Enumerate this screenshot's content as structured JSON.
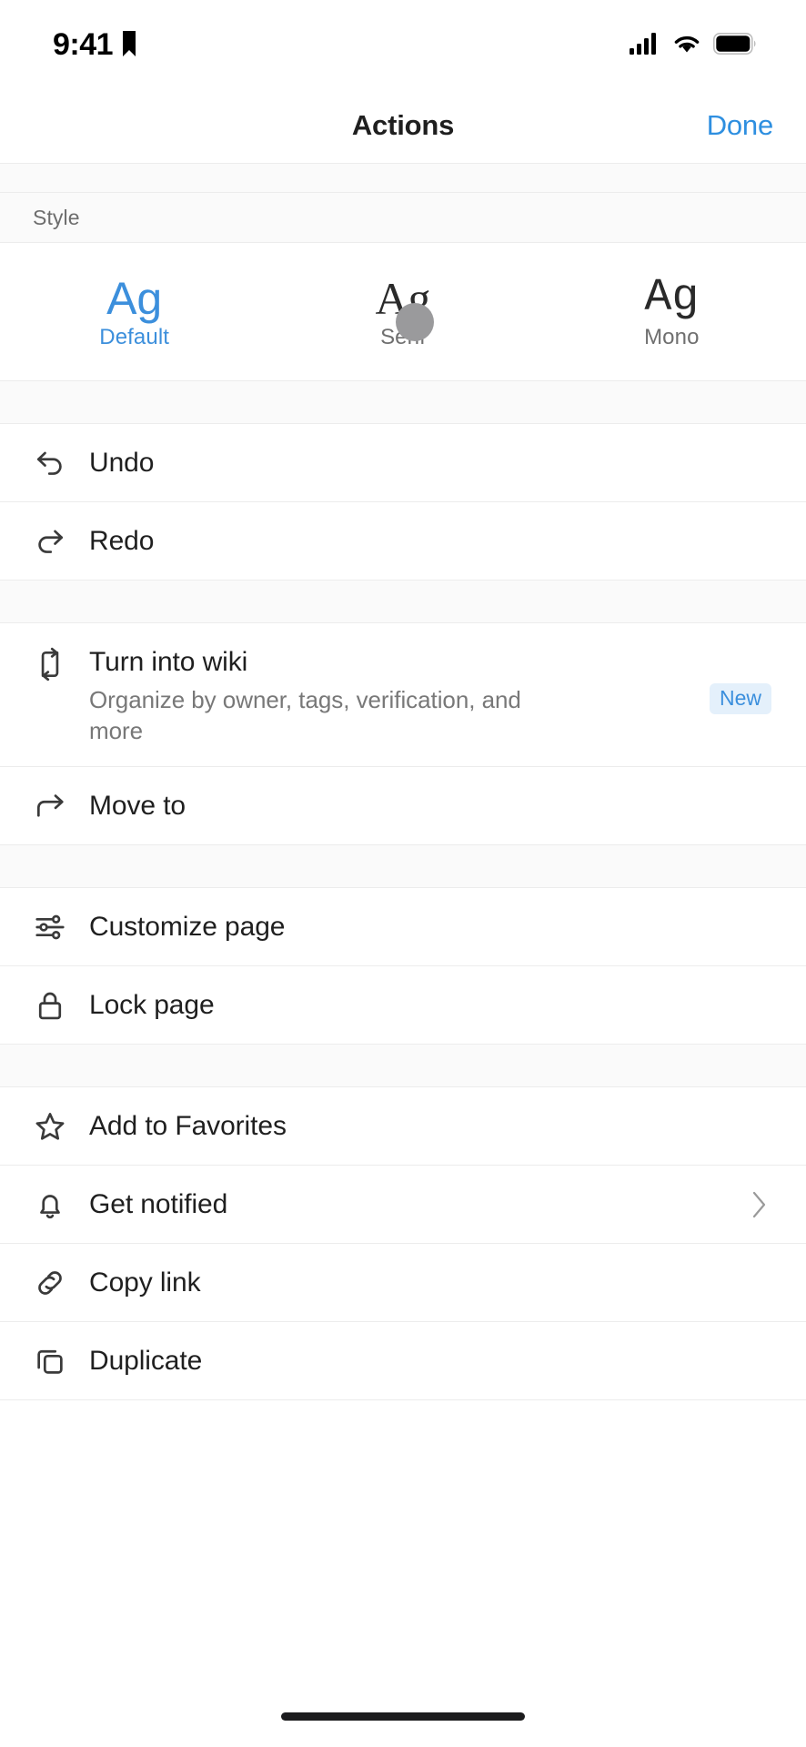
{
  "status_bar": {
    "time": "9:41",
    "bookmark_icon": "bookmark-icon",
    "cellular_icon": "cellular-signal-icon",
    "wifi_icon": "wifi-icon",
    "battery_icon": "battery-icon"
  },
  "nav": {
    "title": "Actions",
    "done_label": "Done",
    "done_color": "#2e8fe0"
  },
  "style_section": {
    "header": "Style",
    "options": [
      {
        "glyph": "Ag",
        "name": "Default",
        "selected": true
      },
      {
        "glyph": "Ag",
        "name": "Serif",
        "selected": false
      },
      {
        "glyph": "Ag",
        "name": "Mono",
        "selected": false
      }
    ],
    "selected_color": "#3c8fdc"
  },
  "menu_groups": [
    {
      "items": [
        {
          "label": "Undo",
          "icon": "undo-arrow-icon"
        },
        {
          "label": "Redo",
          "icon": "redo-arrow-icon"
        }
      ]
    },
    {
      "items": [
        {
          "label": "Turn into wiki",
          "sublabel": "Organize by owner, tags, verification, and more",
          "icon": "swap-vertical-icon",
          "badge": "New",
          "badge_bg": "#e4f0fb",
          "badge_color": "#3b8fdd"
        },
        {
          "label": "Move to",
          "icon": "arrow-move-icon"
        }
      ]
    },
    {
      "items": [
        {
          "label": "Customize page",
          "icon": "sliders-icon"
        },
        {
          "label": "Lock page",
          "icon": "lock-icon"
        }
      ]
    },
    {
      "items": [
        {
          "label": "Add to Favorites",
          "icon": "star-icon"
        },
        {
          "label": "Get notified",
          "icon": "bell-icon",
          "chevron": "chevron-right-icon"
        },
        {
          "label": "Copy link",
          "icon": "link-chain-icon"
        },
        {
          "label": "Duplicate",
          "icon": "duplicate-copy-icon"
        }
      ]
    }
  ],
  "home_indicator": "home-indicator-bar"
}
